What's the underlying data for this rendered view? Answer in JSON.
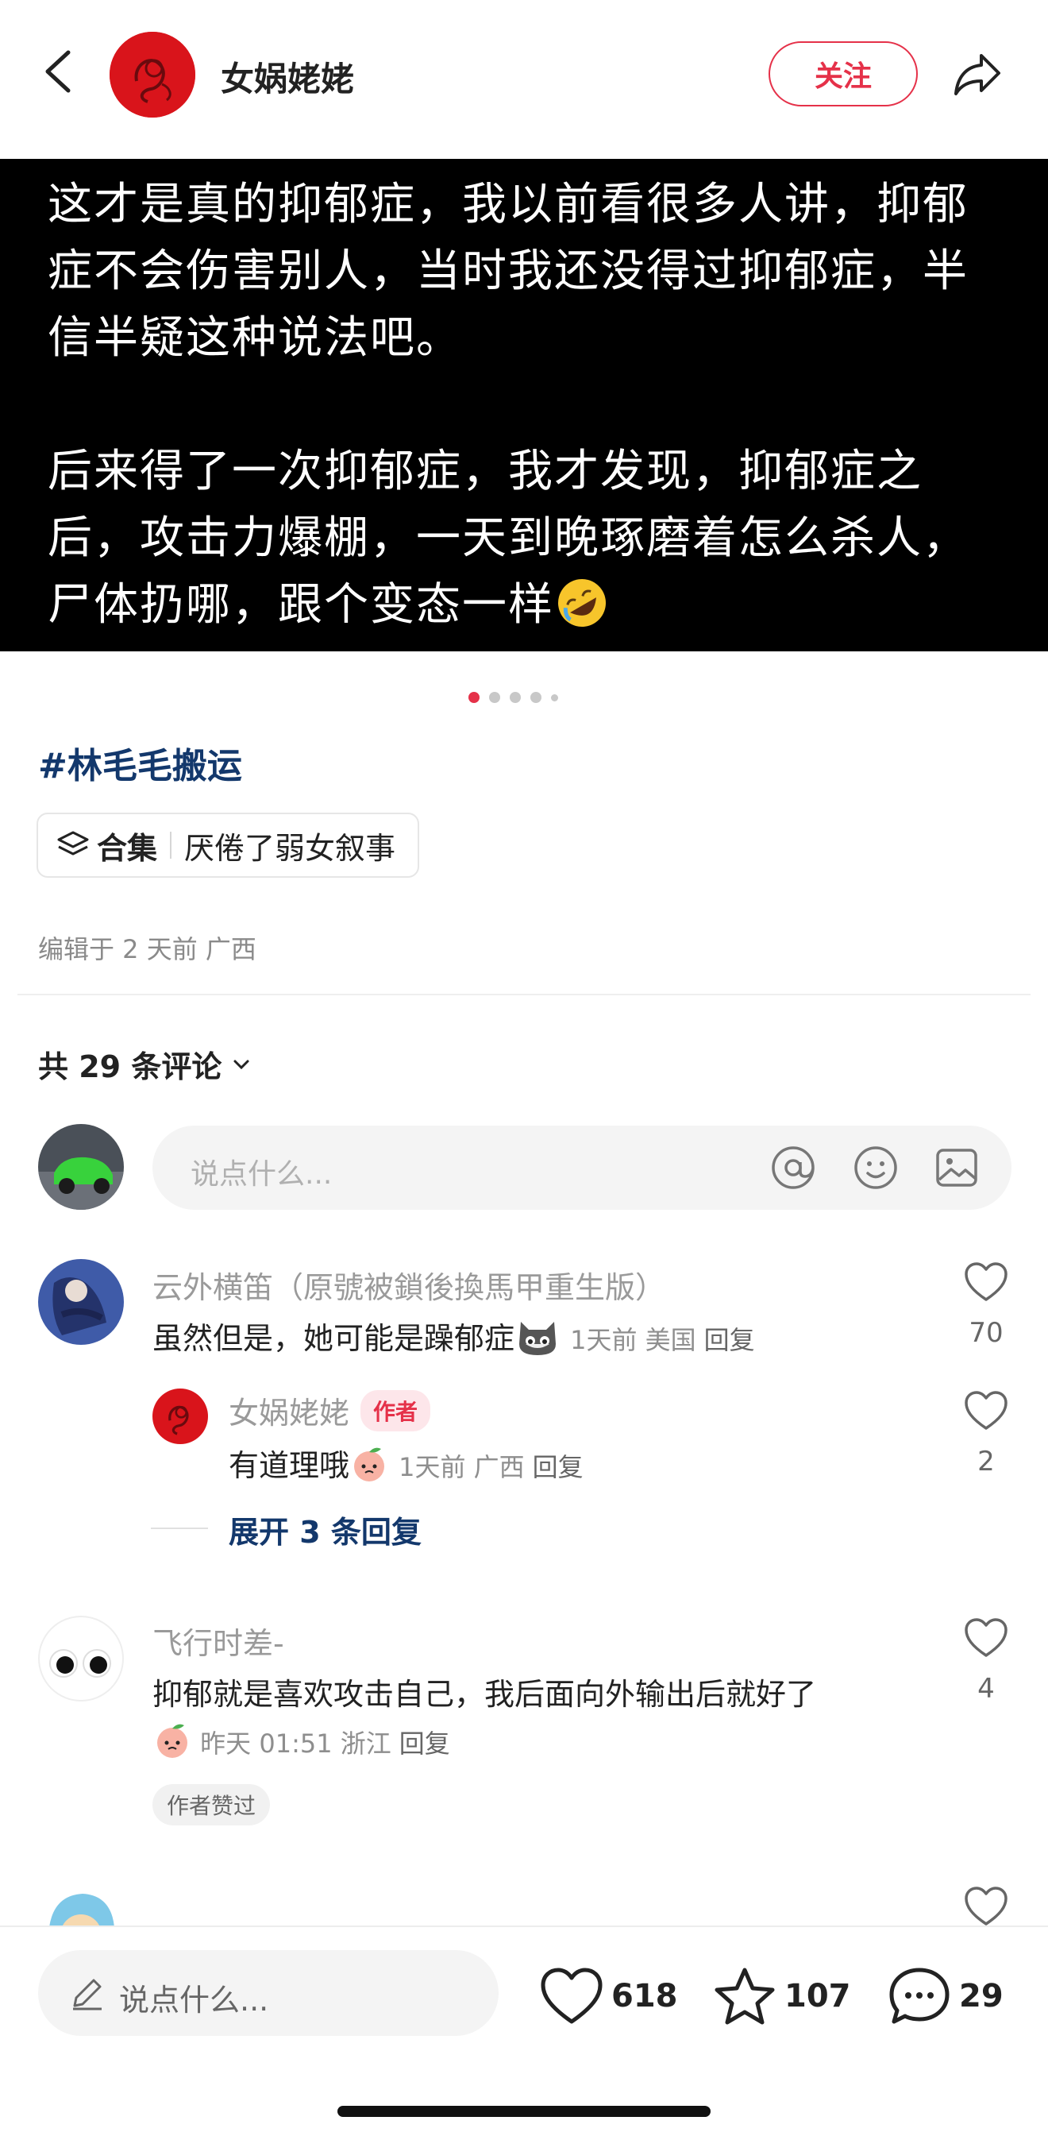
{
  "header": {
    "author_name": "女娲姥姥",
    "follow_label": "关注"
  },
  "post": {
    "image_text": "这才是真的抑郁症，我以前看很多人讲，抑郁症不会伤害别人，当时我还没得过抑郁症，半信半疑这种说法吧。\n\n后来得了一次抑郁症，我才发现，抑郁症之后，攻击力爆棚，一天到晚琢磨着怎么杀人，尸体扔哪，跟个变态一样",
    "image_emoji": "rolling-on-floor-laughing-emoji",
    "carousel_count": 5,
    "carousel_active": 1,
    "hashtag": "#林毛毛搬运",
    "collection_label": "合集",
    "collection_name": "厌倦了弱女叙事",
    "edit_meta": "编辑于 2 天前 广西"
  },
  "comments_section": {
    "count_label": "共 29 条评论",
    "input_placeholder": "说点什么...",
    "input_icons": [
      "at-icon",
      "emoji-icon",
      "image-icon"
    ],
    "expand_label": "展开 3 条回复",
    "comments": [
      {
        "name": "云外横笛（原號被鎖後換馬甲重生版）",
        "text": "虽然但是，她可能是躁郁症",
        "time": "1天前",
        "location": "美国",
        "reply": "回复",
        "likes": "70",
        "emoji": "cat-emoji"
      },
      {
        "name": "女娲姥姥",
        "author_tag": "作者",
        "text": "有道理哦",
        "time": "1天前",
        "location": "广西",
        "reply": "回复",
        "likes": "2",
        "emoji": "peach-emoji"
      },
      {
        "name": "飞行时差-",
        "text": "抑郁就是喜欢攻击自己，我后面向外输出后就好了",
        "time": "昨天 01:51",
        "location": "浙江",
        "reply": "回复",
        "likes": "4",
        "emoji": "peach-emoji",
        "badge": "作者赞过"
      }
    ]
  },
  "bottom_bar": {
    "input_placeholder": "说点什么...",
    "likes": "618",
    "favorites": "107",
    "comments": "29"
  },
  "colors": {
    "accent": "#e53149",
    "hashtag": "#13386c",
    "avatar_red": "#d9141b"
  }
}
